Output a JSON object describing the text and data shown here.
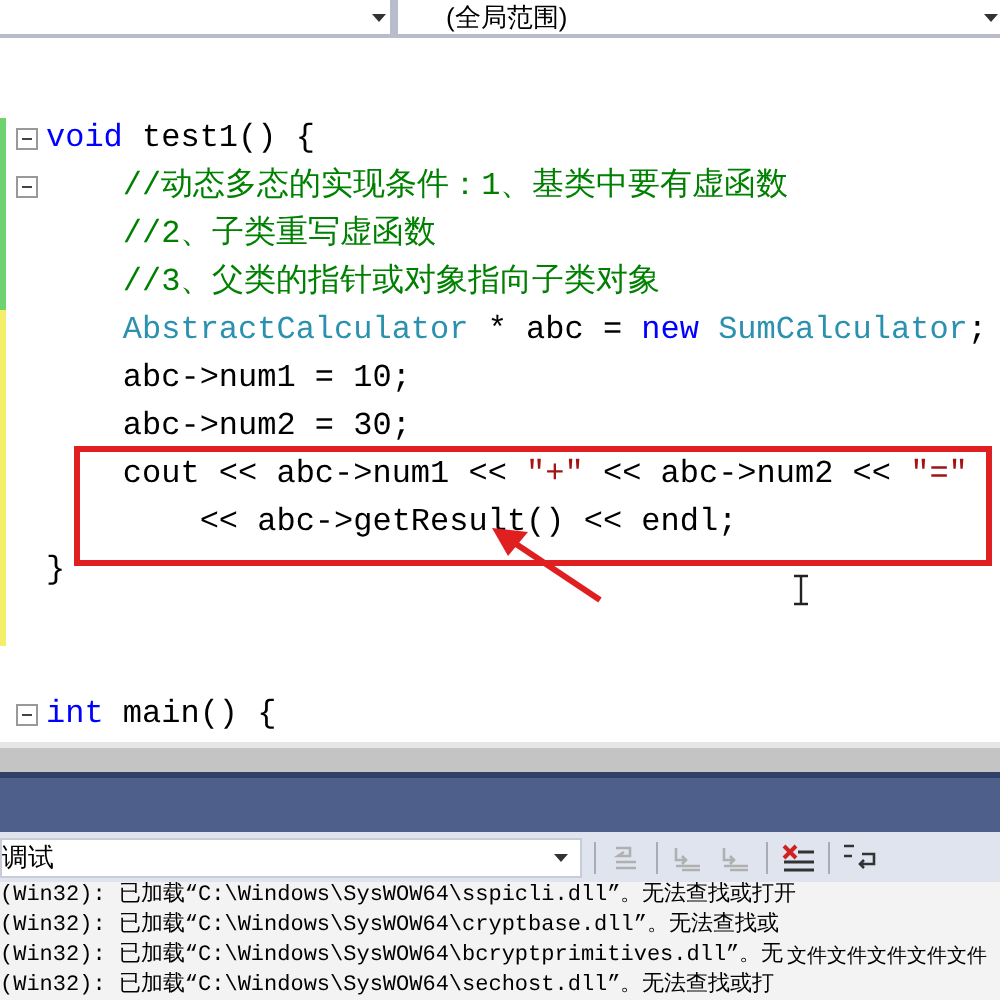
{
  "navigation_bar": {
    "scope_dropdown": "(全局范围)"
  },
  "editor": {
    "blocks": [
      {
        "lines": [
          {
            "fold": true,
            "highlighted": false,
            "tokens": [
              {
                "kind": "keyword",
                "text": "void"
              },
              {
                "kind": "plain",
                "text": " test1() {"
              }
            ]
          },
          {
            "fold": true,
            "highlighted": false,
            "tokens": [
              {
                "kind": "comment",
                "text": "    //动态多态的实现条件：1、基类中要有虚函数"
              }
            ]
          },
          {
            "fold": false,
            "highlighted": false,
            "tokens": [
              {
                "kind": "comment",
                "text": "    //2、子类重写虚函数"
              }
            ]
          },
          {
            "fold": false,
            "highlighted": false,
            "tokens": [
              {
                "kind": "comment",
                "text": "    //3、父类的指针或对象指向子类对象"
              }
            ]
          },
          {
            "fold": false,
            "highlighted": false,
            "tokens": [
              {
                "kind": "type",
                "text": "    AbstractCalculator"
              },
              {
                "kind": "plain",
                "text": " * abc = "
              },
              {
                "kind": "keyword",
                "text": "new"
              },
              {
                "kind": "type",
                "text": " SumCalculator"
              },
              {
                "kind": "plain",
                "text": ";"
              }
            ]
          },
          {
            "fold": false,
            "highlighted": false,
            "tokens": [
              {
                "kind": "plain",
                "text": "    abc->num1 = 10;"
              }
            ]
          },
          {
            "fold": false,
            "highlighted": false,
            "tokens": [
              {
                "kind": "plain",
                "text": "    abc->num2 = 30;"
              }
            ]
          },
          {
            "fold": false,
            "highlighted": true,
            "tokens": [
              {
                "kind": "plain",
                "text": "    cout << abc->num1 << "
              },
              {
                "kind": "string",
                "text": "\"+\""
              },
              {
                "kind": "plain",
                "text": " << abc->num2 << "
              },
              {
                "kind": "string",
                "text": "\"=\""
              }
            ]
          },
          {
            "fold": false,
            "highlighted": true,
            "tokens": [
              {
                "kind": "plain",
                "text": "        << abc->getResult() << endl;"
              }
            ]
          },
          {
            "fold": false,
            "highlighted": false,
            "tokens": [
              {
                "kind": "plain",
                "text": "}"
              }
            ]
          }
        ]
      },
      {
        "lines": [
          {
            "fold": true,
            "highlighted": false,
            "tokens": [
              {
                "kind": "keyword",
                "text": "int"
              },
              {
                "kind": "plain",
                "text": " main() {"
              }
            ]
          }
        ]
      }
    ]
  },
  "output": {
    "source_dropdown": "调试",
    "lines": [
      {
        "text": "(Win32): 已加载“C:\\Windows\\SysWOW64\\sspicli.dll”。无法查找或打开"
      },
      {
        "text": "(Win32): 已加载“C:\\Windows\\SysWOW64\\cryptbase.dll”。无法查找或"
      },
      {
        "text": "(Win32): 已加载“C:\\Windows\\SysWOW64\\bcryptprimitives.dll”。无",
        "overlay": "文件文件文件文件文件"
      },
      {
        "text": "(Win32): 已加载“C:\\Windows\\SysWOW64\\sechost.dll”。无法查找或打"
      }
    ]
  }
}
